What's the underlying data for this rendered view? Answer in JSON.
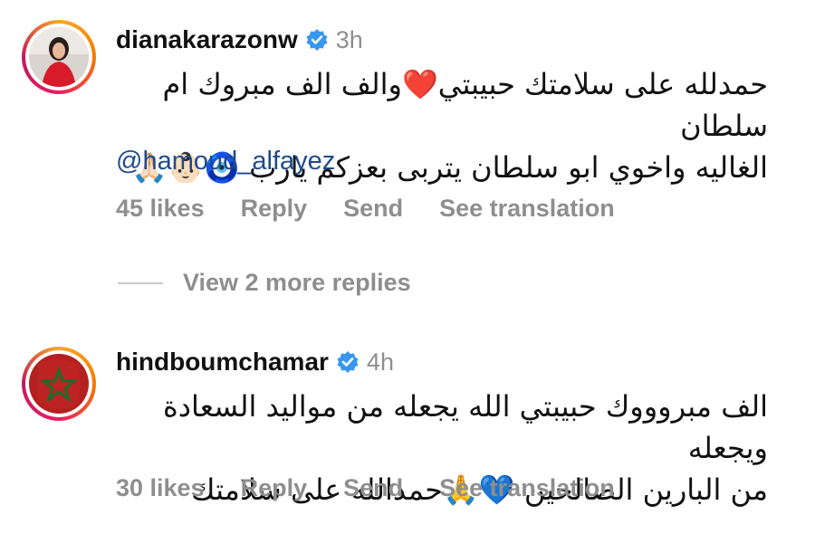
{
  "comments": [
    {
      "username": "dianakarazonw",
      "time": "3h",
      "lines": [
        "حمدلله على سلامتك حبيبتي❤️والف الف مبروك ام سلطان",
        "الغاليه واخوي ابو سلطان يتربى بعزكم يارب 🧿👶🏻🙏🏻"
      ],
      "mention": "@hamoud_alfayez",
      "likes": "45 likes",
      "reply": "Reply",
      "send": "Send",
      "see_translation": "See translation"
    },
    {
      "username": "hindboumchamar",
      "time": "4h",
      "lines": [
        "الف مبروووك حبيبتي الله يجعله من مواليد السعادة ويجعله",
        "من البارين الصالحين 💙🙏حمدالله على سلامتك"
      ],
      "likes": "30 likes",
      "reply": "Reply",
      "send": "Send",
      "see_translation": "See translation"
    }
  ],
  "view_more": "View 2 more replies",
  "colors": {
    "verified": "#3897f0",
    "mention": "#1f4a8c",
    "secondary_text": "#8e8e8e"
  }
}
